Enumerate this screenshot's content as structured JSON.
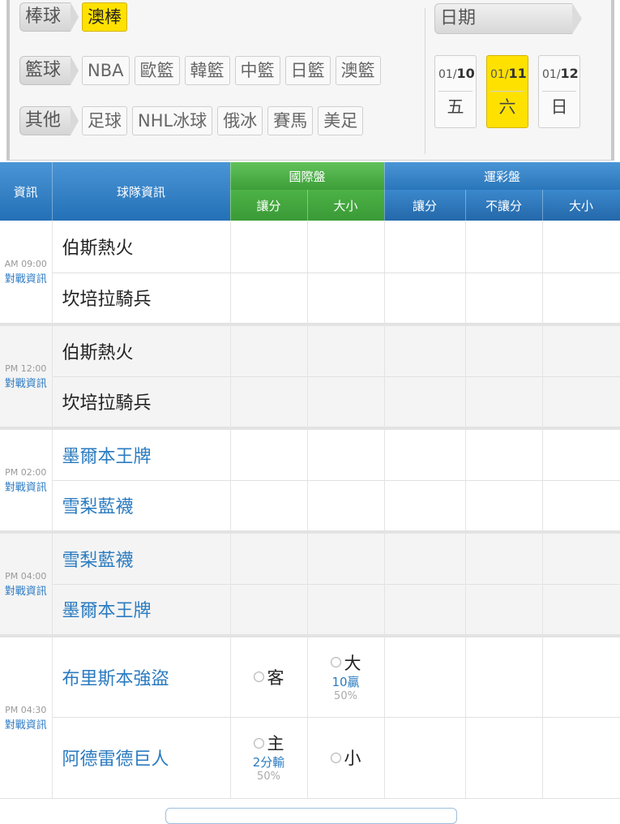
{
  "filters": {
    "rows": [
      {
        "label": "棒球",
        "chips": [
          {
            "text": "澳棒",
            "active": true
          }
        ]
      },
      {
        "label": "籃球",
        "chips": [
          {
            "text": "NBA"
          },
          {
            "text": "歐籃"
          },
          {
            "text": "韓籃"
          },
          {
            "text": "中籃"
          },
          {
            "text": "日籃"
          },
          {
            "text": "澳籃"
          }
        ]
      },
      {
        "label": "其他",
        "chips": [
          {
            "text": "足球"
          },
          {
            "text": "NHL冰球"
          },
          {
            "text": "俄冰"
          },
          {
            "text": "賽馬"
          },
          {
            "text": "美足"
          }
        ]
      }
    ],
    "date_label": "日期",
    "dates": [
      {
        "month": "01/",
        "day": "10",
        "weekday": "五",
        "active": false
      },
      {
        "month": "01/",
        "day": "11",
        "weekday": "六",
        "active": true
      },
      {
        "month": "01/",
        "day": "12",
        "weekday": "日",
        "active": false
      }
    ]
  },
  "table": {
    "headers": {
      "info": "資訊",
      "team": "球隊資訊",
      "intl": "國際盤",
      "intl_spread": "讓分",
      "intl_ou": "大小",
      "lottery": "運彩盤",
      "lot_spread": "讓分",
      "lot_ml": "不讓分",
      "lot_ou": "大小"
    },
    "link_label": "對戰資訊",
    "matches": [
      {
        "time": "AM 09:00",
        "teams": [
          "伯斯熱火",
          "坎培拉騎兵"
        ],
        "team_color": "black",
        "alt": false
      },
      {
        "time": "PM 12:00",
        "teams": [
          "伯斯熱火",
          "坎培拉騎兵"
        ],
        "team_color": "black",
        "alt": true
      },
      {
        "time": "PM 02:00",
        "teams": [
          "墨爾本王牌",
          "雪梨藍襪"
        ],
        "team_color": "blue",
        "alt": false
      },
      {
        "time": "PM 04:00",
        "teams": [
          "雪梨藍襪",
          "墨爾本王牌"
        ],
        "team_color": "blue",
        "alt": true
      }
    ],
    "featured": {
      "time": "PM 04:30",
      "away": {
        "team": "布里斯本強盜",
        "spread_side": "客",
        "ou_side": "大",
        "ou_line": "10贏",
        "ou_pct": "50%"
      },
      "home": {
        "team": "阿德雷德巨人",
        "spread_side": "主",
        "spread_line": "2分輸",
        "spread_pct": "50%",
        "ou_side": "小"
      }
    }
  }
}
